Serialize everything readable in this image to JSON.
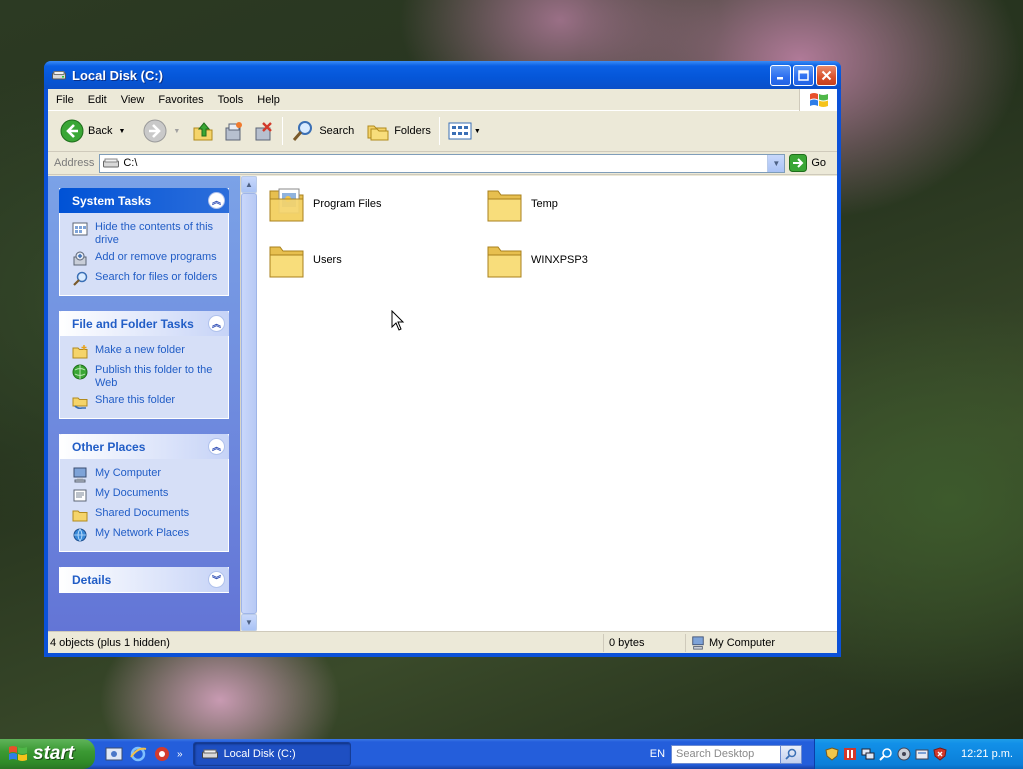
{
  "window": {
    "title": "Local Disk (C:)",
    "minimize_label": "_",
    "maximize_label": "□",
    "close_label": "✕"
  },
  "menu": [
    "File",
    "Edit",
    "View",
    "Favorites",
    "Tools",
    "Help"
  ],
  "toolbar": {
    "back_label": "Back",
    "search_label": "Search",
    "folders_label": "Folders"
  },
  "address": {
    "label": "Address",
    "value": "C:\\",
    "go_label": "Go"
  },
  "taskpane": {
    "system_tasks": {
      "title": "System Tasks",
      "items": [
        "Hide the contents of this drive",
        "Add or remove programs",
        "Search for files or folders"
      ]
    },
    "file_folder_tasks": {
      "title": "File and Folder Tasks",
      "items": [
        "Make a new folder",
        "Publish this folder to the Web",
        "Share this folder"
      ]
    },
    "other_places": {
      "title": "Other Places",
      "items": [
        "My Computer",
        "My Documents",
        "Shared Documents",
        "My Network Places"
      ]
    },
    "details": {
      "title": "Details"
    }
  },
  "files": [
    {
      "name": "Program Files",
      "icon": "program-files-folder-icon"
    },
    {
      "name": "Temp",
      "icon": "folder-icon"
    },
    {
      "name": "Users",
      "icon": "folder-icon"
    },
    {
      "name": "WINXPSP3",
      "icon": "folder-icon"
    }
  ],
  "status": {
    "objects": "4 objects (plus 1 hidden)",
    "size": "0 bytes",
    "location": "My Computer"
  },
  "taskbar": {
    "start_label": "start",
    "quick_more": "»",
    "active_task": "Local Disk (C:)",
    "language": "EN",
    "search_placeholder": "Search Desktop",
    "clock": "12:21 p.m."
  },
  "colors": {
    "title_blue": "#0a5fe4",
    "task_link": "#215dc6",
    "start_green": "#3c9a34"
  }
}
